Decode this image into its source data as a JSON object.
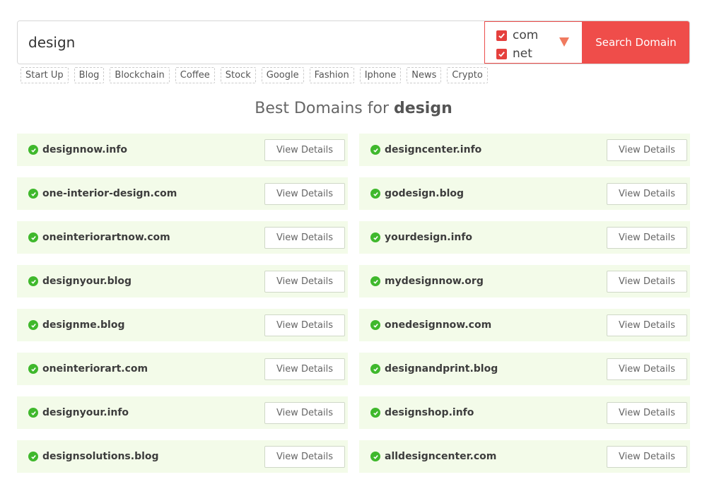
{
  "search": {
    "value": "design",
    "button_label": "Search Domain"
  },
  "tlds": [
    {
      "label": "com",
      "checked": true
    },
    {
      "label": "net",
      "checked": true
    }
  ],
  "tags": [
    "Start Up",
    "Blog",
    "Blockchain",
    "Coffee",
    "Stock",
    "Google",
    "Fashion",
    "Iphone",
    "News",
    "Crypto"
  ],
  "heading": {
    "prefix": "Best Domains for",
    "keyword": "design"
  },
  "details_label": "View Details",
  "domains": [
    "designnow.info",
    "designcenter.info",
    "one-interior-design.com",
    "godesign.blog",
    "oneinteriorartnow.com",
    "yourdesign.info",
    "designyour.blog",
    "mydesignnow.org",
    "designme.blog",
    "onedesignnow.com",
    "oneinteriorart.com",
    "designandprint.blog",
    "designyour.info",
    "designshop.info",
    "designsolutions.blog",
    "alldesigncenter.com"
  ],
  "colors": {
    "accent": "#ef4d4a",
    "available": "#3fb82c",
    "row_bg": "#f3fbe9"
  }
}
